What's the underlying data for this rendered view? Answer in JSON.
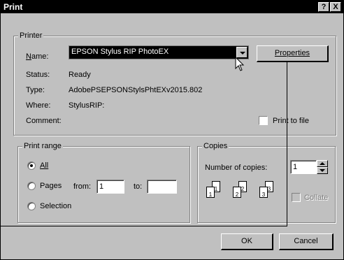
{
  "window": {
    "title": "Print",
    "help_btn": "?",
    "close_btn": "X"
  },
  "printer": {
    "group_label": "Printer",
    "name_label": "Name:",
    "name_value": "EPSON Stylus RIP PhotoEX",
    "properties_label": "Properties",
    "status_label": "Status:",
    "status_value": "Ready",
    "type_label": "Type:",
    "type_value": "AdobePSEPSONStylsPhtEXv2015.802",
    "where_label": "Where:",
    "where_value": "StylusRIP:",
    "comment_label": "Comment:",
    "print_to_file_label": "Print to file"
  },
  "print_range": {
    "group_label": "Print range",
    "all_label": "All",
    "pages_label": "Pages",
    "from_label": "from:",
    "from_value": "1",
    "to_label": "to:",
    "to_value": "",
    "selection_label": "Selection",
    "selected": "all"
  },
  "copies": {
    "group_label": "Copies",
    "number_label": "Number of copies:",
    "number_value": "1",
    "collate_label": "Collate",
    "collate_pages": [
      "1",
      "1",
      "2",
      "2",
      "3",
      "3"
    ]
  },
  "actions": {
    "ok_label": "OK",
    "cancel_label": "Cancel"
  },
  "colors": {
    "face": "#c0c0c0",
    "title_bg": "#000000",
    "selection_bg": "#000000"
  }
}
